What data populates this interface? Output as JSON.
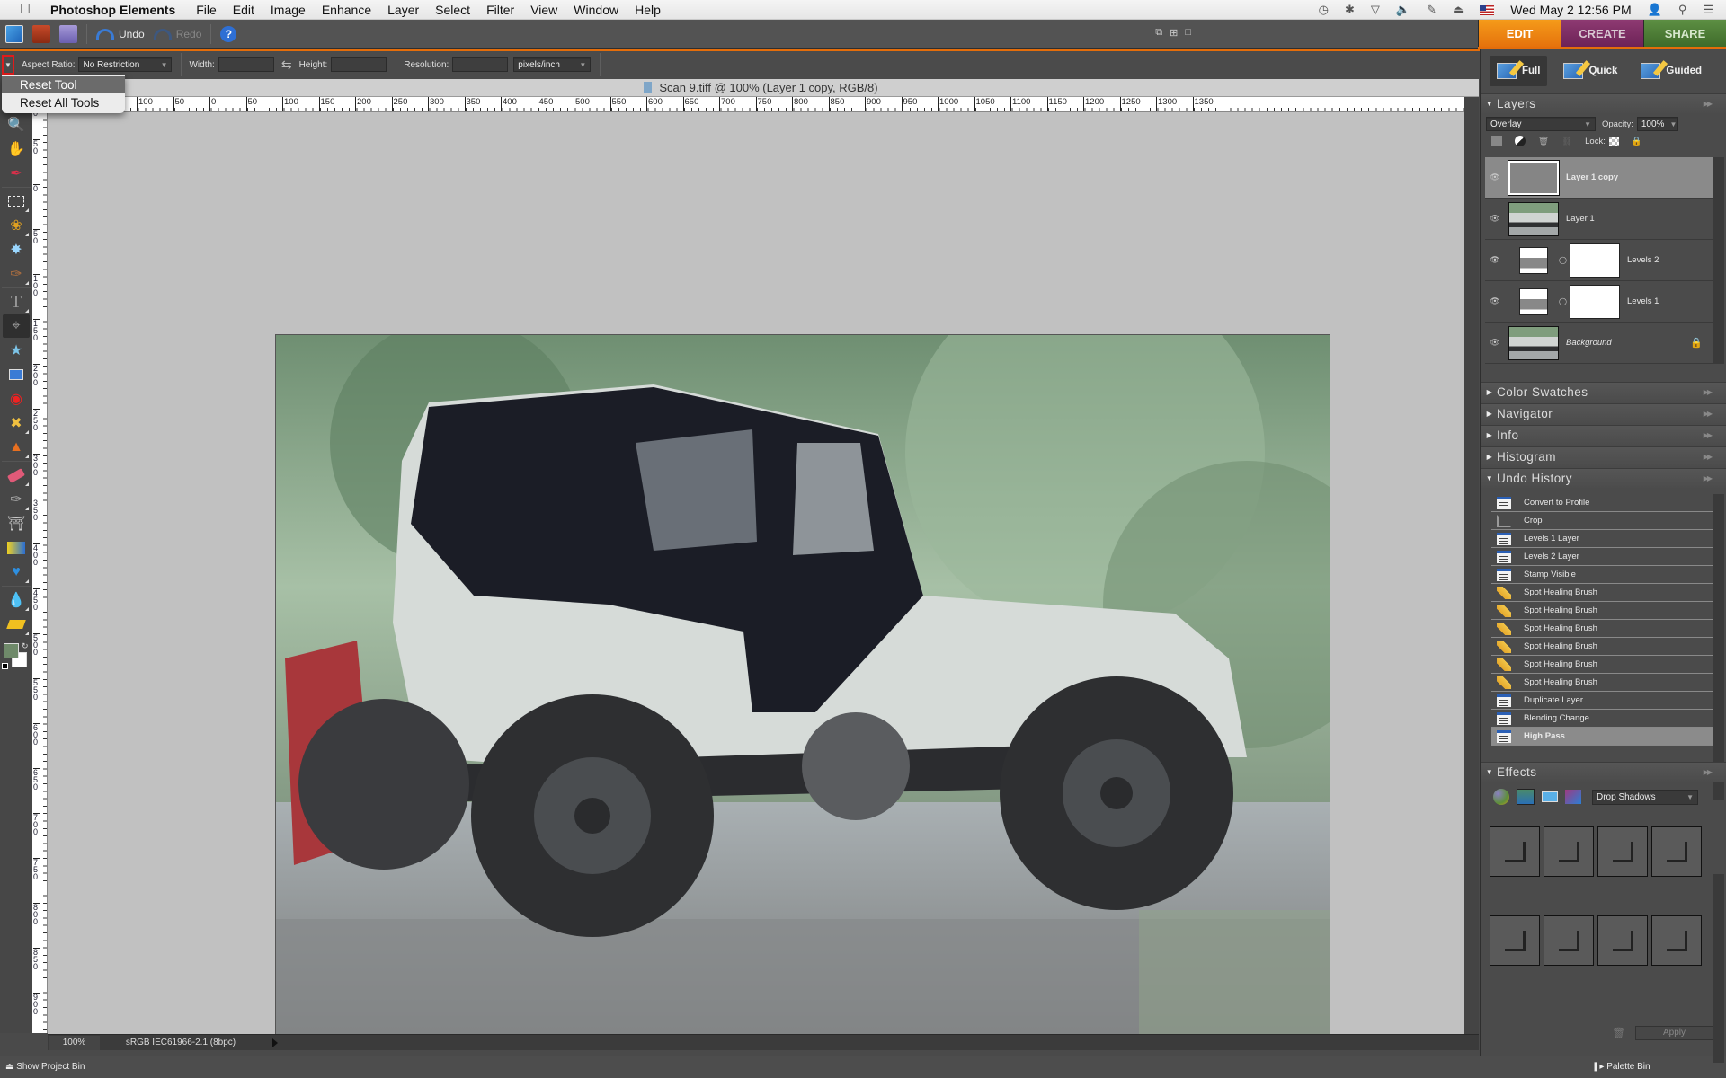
{
  "menubar": {
    "app_name": "Photoshop Elements",
    "items": [
      "File",
      "Edit",
      "Image",
      "Enhance",
      "Layer",
      "Select",
      "Filter",
      "View",
      "Window",
      "Help"
    ],
    "clock": "Wed May 2  12:56 PM"
  },
  "toolbar": {
    "undo_label": "Undo",
    "redo_label": "Redo",
    "help_label": "?"
  },
  "mode_tabs": {
    "edit": "EDIT",
    "create": "CREATE",
    "share": "SHARE",
    "active": "EDIT"
  },
  "options_bar": {
    "aspect_label": "Aspect Ratio:",
    "aspect_value": "No Restriction",
    "width_label": "Width:",
    "width_value": "",
    "height_label": "Height:",
    "height_value": "",
    "resolution_label": "Resolution:",
    "resolution_value": "",
    "units_value": "pixels/inch"
  },
  "tool_menu": {
    "items": [
      "Reset Tool",
      "Reset All Tools"
    ],
    "highlighted": "Reset Tool"
  },
  "document": {
    "title": "Scan 9.tiff @ 100% (Layer 1 copy, RGB/8)",
    "zoom": "100%",
    "profile": "sRGB IEC61966-2.1 (8bpc)"
  },
  "rulers": {
    "horizontal": [
      "100",
      "50",
      "0",
      "50",
      "100",
      "150",
      "200",
      "250",
      "300",
      "350",
      "400",
      "450",
      "500",
      "550",
      "600",
      "650",
      "700",
      "750",
      "800",
      "850",
      "900",
      "950",
      "1000",
      "1050",
      "1100",
      "1150",
      "1200",
      "1250",
      "1300",
      "1350"
    ],
    "vertical": [
      "100",
      "50",
      "0",
      "50",
      "100",
      "150",
      "200",
      "250",
      "300",
      "350",
      "400",
      "450",
      "500",
      "550",
      "600",
      "650",
      "700",
      "750",
      "800",
      "850",
      "900"
    ]
  },
  "panel": {
    "modes": [
      "Full",
      "Quick",
      "Guided"
    ],
    "active_mode": "Full",
    "layers": {
      "title": "Layers",
      "blend_mode": "Overlay",
      "opacity_label": "Opacity:",
      "opacity_value": "100%",
      "lock_label": "Lock:",
      "items": [
        {
          "name": "Layer 1 copy",
          "type": "gray",
          "selected": true
        },
        {
          "name": "Layer 1",
          "type": "photo"
        },
        {
          "name": "Levels 2",
          "type": "adjustment"
        },
        {
          "name": "Levels 1",
          "type": "adjustment"
        },
        {
          "name": "Background",
          "type": "photo",
          "locked": true
        }
      ]
    },
    "collapsed_panels": [
      "Color Swatches",
      "Navigator",
      "Info",
      "Histogram"
    ],
    "undo_history": {
      "title": "Undo History",
      "items": [
        {
          "label": "Convert to Profile",
          "icon": "doc"
        },
        {
          "label": "Crop",
          "icon": "crop"
        },
        {
          "label": "Levels 1 Layer",
          "icon": "doc"
        },
        {
          "label": "Levels 2 Layer",
          "icon": "doc"
        },
        {
          "label": "Stamp Visible",
          "icon": "doc"
        },
        {
          "label": "Spot Healing Brush",
          "icon": "bandage"
        },
        {
          "label": "Spot Healing Brush",
          "icon": "bandage"
        },
        {
          "label": "Spot Healing Brush",
          "icon": "bandage"
        },
        {
          "label": "Spot Healing Brush",
          "icon": "bandage"
        },
        {
          "label": "Spot Healing Brush",
          "icon": "bandage"
        },
        {
          "label": "Spot Healing Brush",
          "icon": "bandage"
        },
        {
          "label": "Duplicate Layer",
          "icon": "doc"
        },
        {
          "label": "Blending Change",
          "icon": "doc"
        },
        {
          "label": "High Pass",
          "icon": "doc",
          "selected": true
        }
      ]
    },
    "effects": {
      "title": "Effects",
      "category": "Drop Shadows",
      "apply_label": "Apply"
    }
  },
  "bottom": {
    "project_bin": "Show Project Bin",
    "palette_bin": "Palette Bin"
  }
}
